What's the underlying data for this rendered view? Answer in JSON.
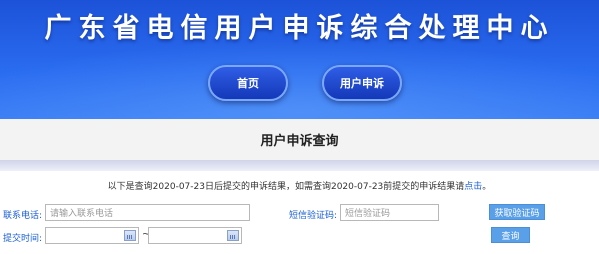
{
  "header": {
    "site_title": "广东省电信用户申诉综合处理中心",
    "nav": [
      {
        "label": "首页"
      },
      {
        "label": "用户申诉"
      }
    ]
  },
  "section": {
    "title": "用户申诉查询"
  },
  "notice": {
    "text": "以下是查询2020-07-23日后提交的申诉结果，如需查询2020-07-23前提交的申诉结果请",
    "link": "点击",
    "end": "。"
  },
  "form": {
    "phone_label": "联系电话:",
    "phone_placeholder": "请输入联系电话",
    "code_label": "短信验证码:",
    "code_placeholder": "短信验证码",
    "get_code_button": "获取验证码",
    "date_label": "提交时间:",
    "date_separator": "~",
    "query_button": "查询"
  },
  "colors": {
    "banner": "#2a6cf0",
    "label": "#1a5fd8",
    "button": "#5aa0e8"
  }
}
